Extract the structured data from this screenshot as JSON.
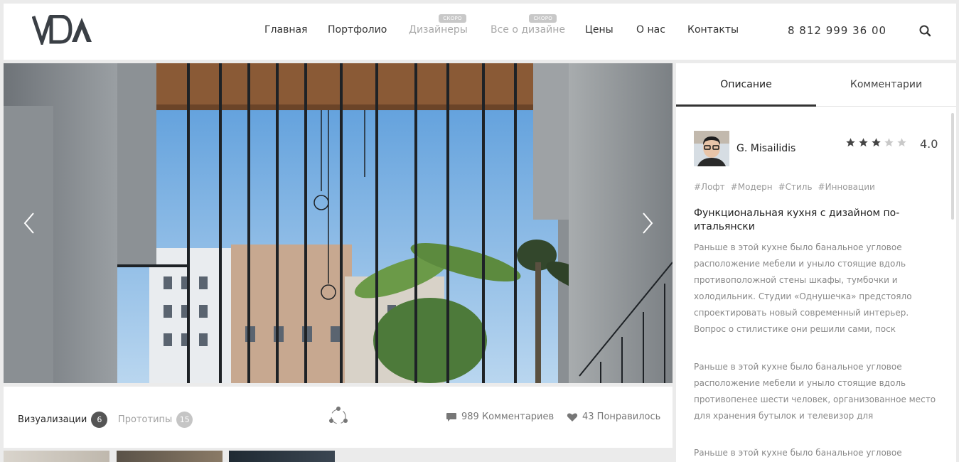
{
  "header": {
    "logo_text": "VDA",
    "nav": [
      {
        "label": "Главная",
        "muted": false,
        "badge": ""
      },
      {
        "label": "Портфолио",
        "muted": false,
        "badge": ""
      },
      {
        "label": "Дизайнеры",
        "muted": true,
        "badge": "СКОРО"
      },
      {
        "label": "Все о дизайне",
        "muted": true,
        "badge": "СКОРО"
      },
      {
        "label": "Цены",
        "muted": false,
        "badge": ""
      },
      {
        "label": "О нас",
        "muted": false,
        "badge": ""
      },
      {
        "label": "Контакты",
        "muted": false,
        "badge": ""
      }
    ],
    "phone": "8 812 999 36 00",
    "search_icon": "search-icon"
  },
  "gallery": {
    "prev_icon": "chevron-left-icon",
    "next_icon": "chevron-right-icon"
  },
  "bottom_bar": {
    "visualizations_label": "Визуализации",
    "visualizations_count": "6",
    "prototypes_label": "Прототипы",
    "prototypes_count": "15",
    "share_icon": "share-icon",
    "comments": "989 Комментариев",
    "likes": "43 Понравилось"
  },
  "sidebar": {
    "tabs": [
      {
        "label": "Описание",
        "active": true
      },
      {
        "label": "Комментарии",
        "active": false
      }
    ],
    "designer": {
      "name": "G. Misailidis",
      "rating_value": "4.0",
      "stars_filled": 3,
      "stars_total": 5
    },
    "tags": [
      "#Лофт",
      "#Модерн",
      "#Стиль",
      "#Инновации"
    ],
    "project_title": "Функциональная кухня с дизайном по-итальянски",
    "paragraphs": [
      "Раньше в этой кухне было банальное угловое расположение мебели и уныло стоящие вдоль противоположной стены шкафы, тумбочки и холодильник. Студии «Однушечка» предстояло спроектировать новый современный интерьер. Вопрос о стилистике они решили сами, поск",
      "Раньше в этой кухне было банальное угловое расположение мебели и уныло стоящие вдоль противопенее шести человек, организованное место для хранения бутылок и телевизор для",
      "Раньше в этой кухне было банальное угловое"
    ]
  },
  "colors": {
    "accent_dark": "#333333",
    "muted_text": "#a8a8a8",
    "badge_bg": "#c8c8c8"
  }
}
